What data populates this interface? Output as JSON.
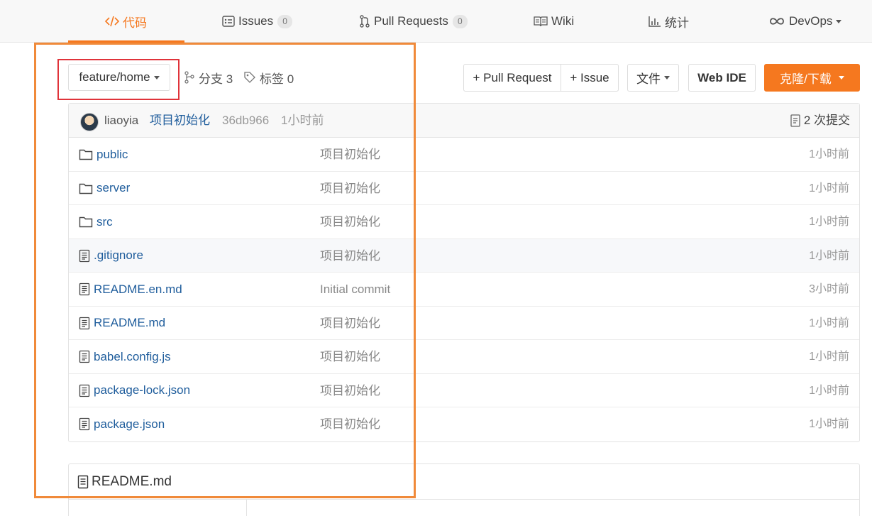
{
  "nav": {
    "tabs": [
      {
        "label": "代码",
        "icon": "code-icon",
        "active": true
      },
      {
        "label": "Issues",
        "icon": "issues-icon",
        "count": "0"
      },
      {
        "label": "Pull Requests",
        "icon": "pull-request-icon",
        "count": "0"
      },
      {
        "label": "Wiki",
        "icon": "wiki-icon"
      },
      {
        "label": "统计",
        "icon": "stats-icon"
      },
      {
        "label": "DevOps",
        "icon": "infinity-icon"
      }
    ]
  },
  "repo": {
    "branch": "feature/home",
    "branches_label": "分支 3",
    "tags_label": "标签 0"
  },
  "actions": {
    "pull_request": "+ Pull Request",
    "issue": "+ Issue",
    "file": "文件",
    "web_ide": "Web IDE",
    "clone": "克隆/下载"
  },
  "latest_commit": {
    "author": "liaoyia",
    "message": "项目初始化",
    "hash": "36db966",
    "time": "1小时前",
    "commits_label": "2 次提交"
  },
  "files": [
    {
      "name": "public",
      "type": "folder",
      "message": "项目初始化",
      "time": "1小时前"
    },
    {
      "name": "server",
      "type": "folder",
      "message": "项目初始化",
      "time": "1小时前"
    },
    {
      "name": "src",
      "type": "folder",
      "message": "项目初始化",
      "time": "1小时前"
    },
    {
      "name": ".gitignore",
      "type": "file",
      "message": "项目初始化",
      "time": "1小时前"
    },
    {
      "name": "README.en.md",
      "type": "file",
      "message": "Initial commit",
      "time": "3小时前"
    },
    {
      "name": "README.md",
      "type": "file",
      "message": "项目初始化",
      "time": "1小时前"
    },
    {
      "name": "babel.config.js",
      "type": "file",
      "message": "项目初始化",
      "time": "1小时前"
    },
    {
      "name": "package-lock.json",
      "type": "file",
      "message": "项目初始化",
      "time": "1小时前"
    },
    {
      "name": "package.json",
      "type": "file",
      "message": "项目初始化",
      "time": "1小时前"
    }
  ],
  "readme": {
    "title": "README.md"
  },
  "colors": {
    "accent": "#f5781f",
    "link": "#1f5d9c",
    "highlight_orange": "#f08a3a",
    "highlight_red": "#e0333a"
  }
}
